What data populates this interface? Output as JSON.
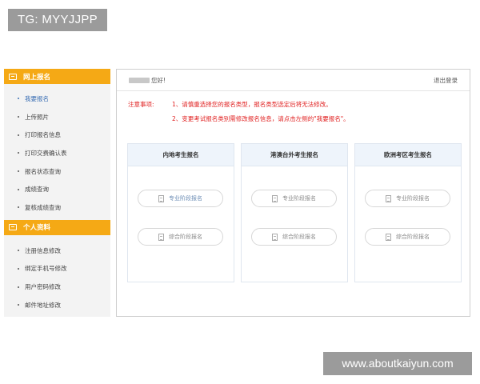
{
  "watermark_tag": "TG: MYYJJPP",
  "watermark_url": "www.aboutkaiyun.com",
  "sidebar": {
    "section1_title": "网上报名",
    "section1_items": [
      {
        "label": "我要报名"
      },
      {
        "label": "上传照片"
      },
      {
        "label": "打印报名信息"
      },
      {
        "label": "打印交费确认表"
      },
      {
        "label": "报名状态查询"
      },
      {
        "label": "成绩查询"
      },
      {
        "label": "复核成绩查询"
      }
    ],
    "section2_title": "个人资料",
    "section2_items": [
      {
        "label": "注册信息修改"
      },
      {
        "label": "绑定手机号修改"
      },
      {
        "label": "用户密码修改"
      },
      {
        "label": "邮件地址修改"
      }
    ]
  },
  "header": {
    "greeting": "您好!",
    "logout": "退出登录"
  },
  "notice": {
    "label": "注意事项:",
    "line1": "1、请慎重选择您的报名类型，报名类型选定后将无法修改。",
    "line2": "2、变更考试报名类别需修改报名信息，请点击左侧的\"我要报名\"。"
  },
  "cards": [
    {
      "title": "内地考生报名",
      "button1": "专业阶段报名",
      "button2": "综合阶段报名"
    },
    {
      "title": "港澳台外考生报名",
      "button1": "专业阶段报名",
      "button2": "综合阶段报名"
    },
    {
      "title": "欧洲考区考生报名",
      "button1": "专业阶段报名",
      "button2": "综合阶段报名"
    }
  ],
  "colors": {
    "accent": "#f5a915",
    "notice_red": "#e02020",
    "active_link": "#3b6fb4"
  }
}
